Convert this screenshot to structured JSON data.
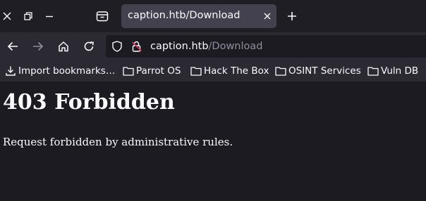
{
  "tab": {
    "title": "caption.htb/Download"
  },
  "url": {
    "host": "caption.htb",
    "path": "/Download"
  },
  "bookmarks": [
    {
      "label": "Import bookmarks…",
      "icon": "import-icon"
    },
    {
      "label": "Parrot OS",
      "icon": "folder-icon"
    },
    {
      "label": "Hack The Box",
      "icon": "folder-icon"
    },
    {
      "label": "OSINT Services",
      "icon": "folder-icon"
    },
    {
      "label": "Vuln DB",
      "icon": "folder-icon"
    }
  ],
  "page": {
    "heading": "403 Forbidden",
    "message": "Request forbidden by administrative rules."
  },
  "colors": {
    "tab_active": "#42414d",
    "toolbar": "#2b2a33",
    "content_bg": "#1c1b22",
    "text": "#fbfbfe",
    "url_path": "#8f8f9d",
    "insecure_red": "#e22850"
  }
}
